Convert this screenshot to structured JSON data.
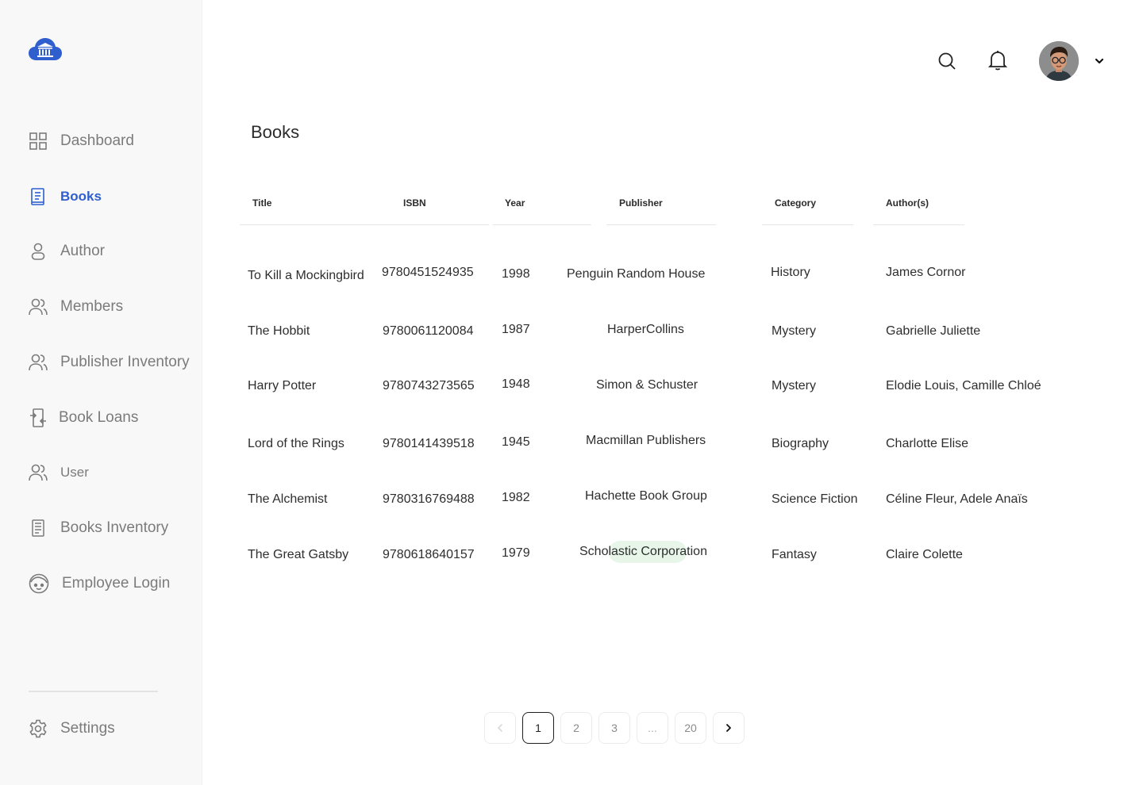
{
  "sidebar": {
    "items": [
      {
        "label": "Dashboard",
        "icon": "grid-icon"
      },
      {
        "label": "Books",
        "icon": "book-icon",
        "active": true
      },
      {
        "label": "Author",
        "icon": "person-icon"
      },
      {
        "label": "Members",
        "icon": "users-icon"
      },
      {
        "label": "Publisher Inventory",
        "icon": "users-icon"
      },
      {
        "label": "Book Loans",
        "icon": "loan-icon"
      },
      {
        "label": "User",
        "icon": "users-icon"
      },
      {
        "label": "Books Inventory",
        "icon": "document-icon"
      },
      {
        "label": "Employee Login",
        "icon": "face-icon"
      }
    ],
    "settings_label": "Settings"
  },
  "header": {
    "search_icon": "search-icon",
    "bell_icon": "bell-icon"
  },
  "page": {
    "title": "Books"
  },
  "table": {
    "columns": [
      "Title",
      "ISBN",
      "Year",
      "Publisher",
      "Category",
      "Author(s)"
    ],
    "rows": [
      {
        "title": "To Kill a Mockingbird",
        "isbn": "9780451524935",
        "year": "1998",
        "publisher": "Penguin Random House",
        "category": "History",
        "authors": "James Cornor"
      },
      {
        "title": "The Hobbit",
        "isbn": "9780061120084",
        "year": "1987",
        "publisher": "HarperCollins",
        "category": "Mystery",
        "authors": "Gabrielle Juliette"
      },
      {
        "title": "Harry Potter",
        "isbn": "9780743273565",
        "year": "1948",
        "publisher": "Simon & Schuster",
        "category": "Mystery",
        "authors": "Elodie Louis, Camille Chloé"
      },
      {
        "title": "Lord of the Rings",
        "isbn": "9780141439518",
        "year": "1945",
        "publisher": "Macmillan Publishers",
        "category": "Biography",
        "authors": "Charlotte Elise"
      },
      {
        "title": "The Alchemist",
        "isbn": "9780316769488",
        "year": "1982",
        "publisher": "Hachette Book Group",
        "category": "Science Fiction",
        "authors": "Céline Fleur, Adele Anaïs"
      },
      {
        "title": "The Great Gatsby",
        "isbn": "9780618640157",
        "year": "1979",
        "publisher": "Scholastic Corporation",
        "category": "Fantasy",
        "authors": "Claire Colette"
      }
    ]
  },
  "pagination": {
    "pages": [
      "1",
      "2",
      "3",
      "...",
      "20"
    ],
    "current": "1"
  },
  "colors": {
    "accent": "#2f5fce",
    "sidebar_bg": "#f8f8f8",
    "highlight": "#e7f6e9"
  }
}
